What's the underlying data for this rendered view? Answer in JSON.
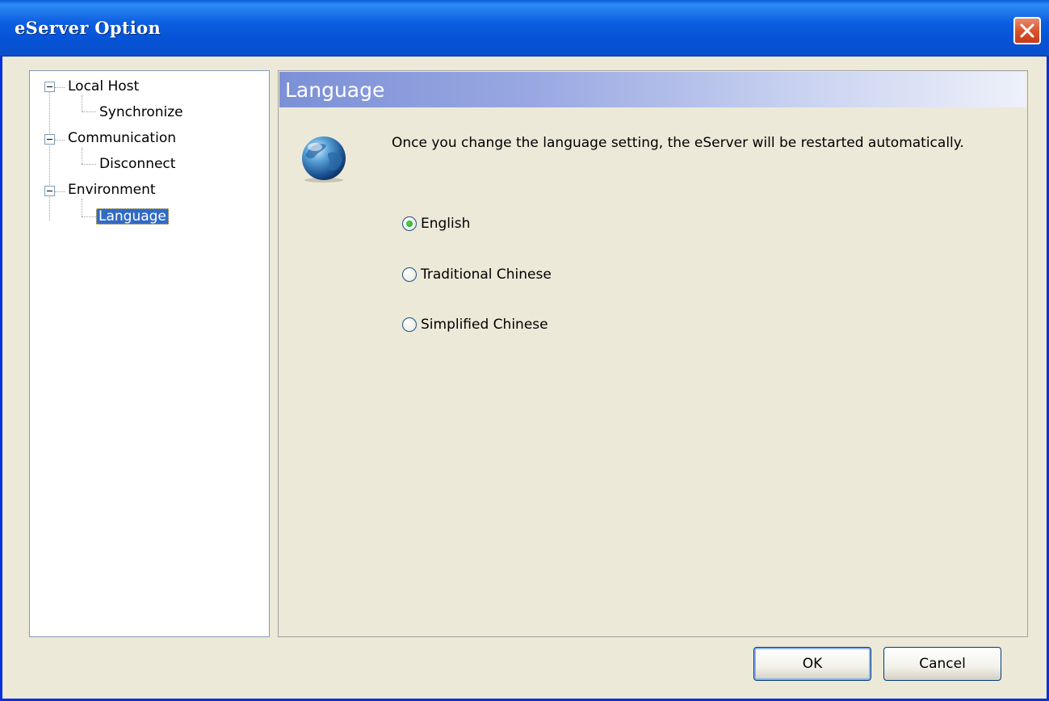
{
  "window": {
    "title": "eServer Option"
  },
  "tree": {
    "items": [
      {
        "label": "Local Host",
        "level": 0,
        "expanded": true
      },
      {
        "label": "Synchronize",
        "level": 1
      },
      {
        "label": "Communication",
        "level": 0,
        "expanded": true
      },
      {
        "label": "Disconnect",
        "level": 1
      },
      {
        "label": "Environment",
        "level": 0,
        "expanded": true
      },
      {
        "label": "Language",
        "level": 1,
        "selected": true
      }
    ]
  },
  "panel": {
    "title": "Language",
    "icon": "globe-icon",
    "description": "Once you change the language setting, the eServer will be restarted automatically.",
    "options": [
      {
        "label": "English",
        "checked": true
      },
      {
        "label": "Traditional Chinese",
        "checked": false
      },
      {
        "label": "Simplified Chinese",
        "checked": false
      }
    ]
  },
  "buttons": {
    "ok": "OK",
    "cancel": "Cancel"
  },
  "colors": {
    "titlebar": "#0553d6",
    "close": "#d9542c",
    "selection": "#316ac5",
    "radio_checked": "#21a121"
  }
}
